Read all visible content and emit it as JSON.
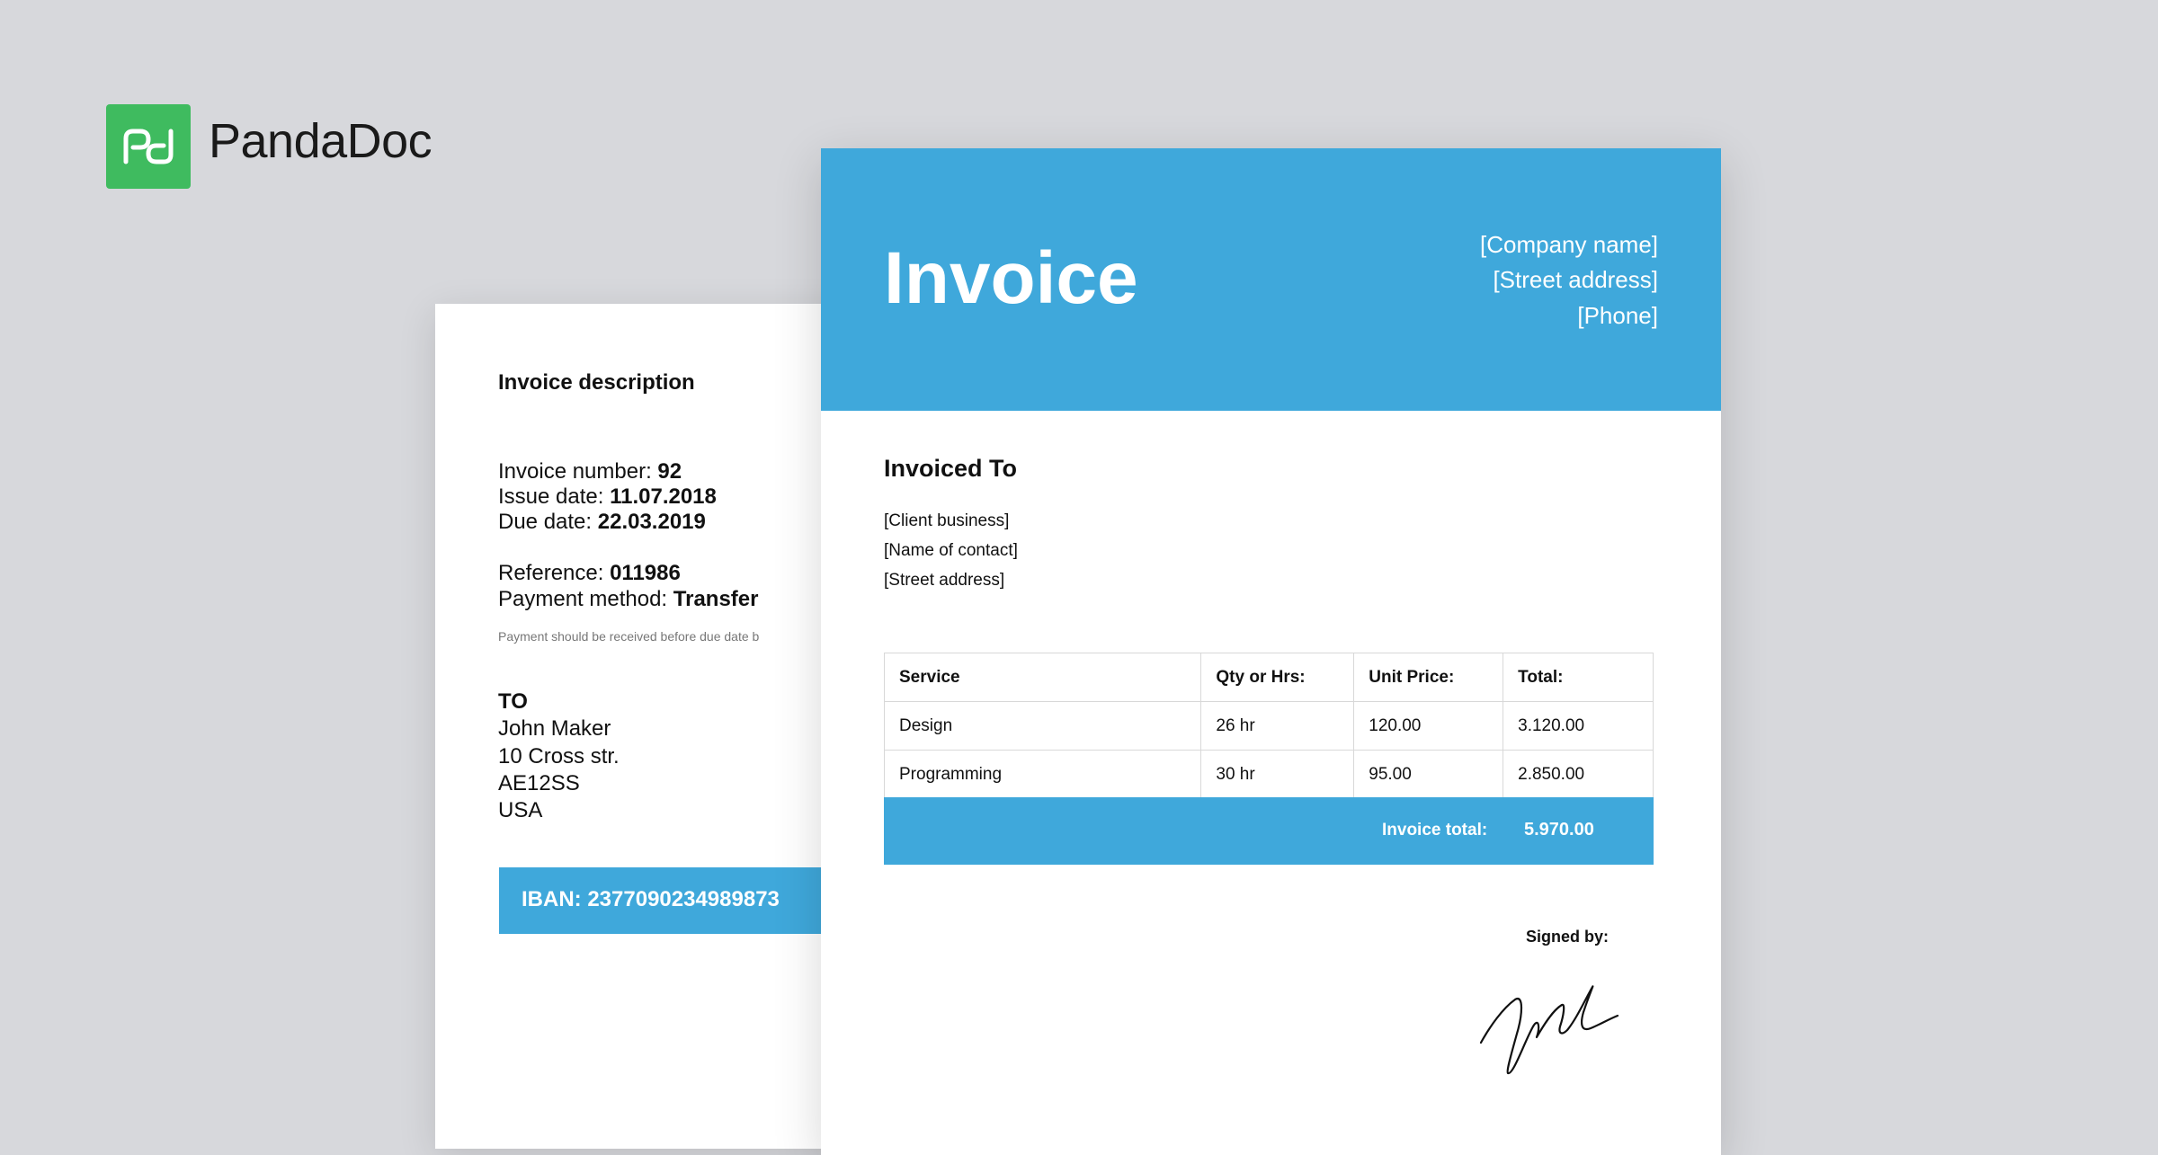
{
  "brand": {
    "logo_icon": "pandadoc-logo-icon",
    "name": "PandaDoc",
    "color": "#3fbb5f"
  },
  "colors": {
    "accent": "#3fa8db",
    "background": "#d7d8dc"
  },
  "back_page": {
    "section_title": "Invoice description",
    "invoice_number_label": "Invoice number: ",
    "invoice_number": "92",
    "issue_date_label": "Issue date: ",
    "issue_date": "11.07.2018",
    "due_date_label": "Due date: ",
    "due_date": "22.03.2019",
    "reference_label": "Reference: ",
    "reference": "011986",
    "payment_method_label": "Payment method: ",
    "payment_method": "Transfer",
    "payment_note": "Payment should be received before due date b",
    "to_label": "TO",
    "recipient": [
      "John Maker",
      "10 Cross str.",
      "AE12SS",
      "USA"
    ],
    "iban": "IBAN: 2377090234989873"
  },
  "front_page": {
    "title": "Invoice",
    "company": {
      "name": "[Company name]",
      "street": "[Street address]",
      "phone": "[Phone]"
    },
    "invoiced_to_label": "Invoiced To",
    "client": {
      "business": "[Client business]",
      "contact": "[Name of contact]",
      "street": "[Street address]"
    },
    "table": {
      "headers": [
        "Service",
        "Qty or Hrs:",
        "Unit Price:",
        "Total:"
      ],
      "rows": [
        [
          "Design",
          "26 hr",
          "120.00",
          "3.120.00"
        ],
        [
          "Programming",
          "30 hr",
          "95.00",
          "2.850.00"
        ]
      ]
    },
    "invoice_total_label": "Invoice total:",
    "invoice_total": "5.970.00",
    "signed_by_label": "Signed by:"
  }
}
